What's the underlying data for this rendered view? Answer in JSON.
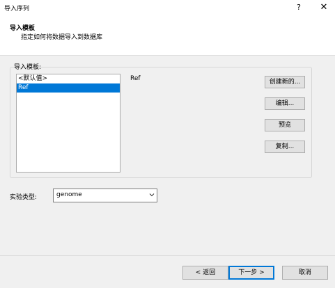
{
  "window": {
    "title": "导入序列",
    "help_glyph": "?",
    "close_glyph": "✕"
  },
  "header": {
    "title": "导入模板",
    "subtitle": "指定如何将数据导入到数据库"
  },
  "templates": {
    "label": "导入模板:",
    "items": [
      "<默认值>",
      "Ref"
    ],
    "selected_index": 1,
    "selected_name": "Ref"
  },
  "side_buttons": {
    "create": "创建新的...",
    "edit": "编辑...",
    "preview": "预览",
    "copy": "复制..."
  },
  "experiment": {
    "label": "实验类型:",
    "value": "genome"
  },
  "footer": {
    "back": "< 返回",
    "next": "下一步 >",
    "cancel": "取消"
  },
  "colors": {
    "selection": "#0078d7"
  }
}
